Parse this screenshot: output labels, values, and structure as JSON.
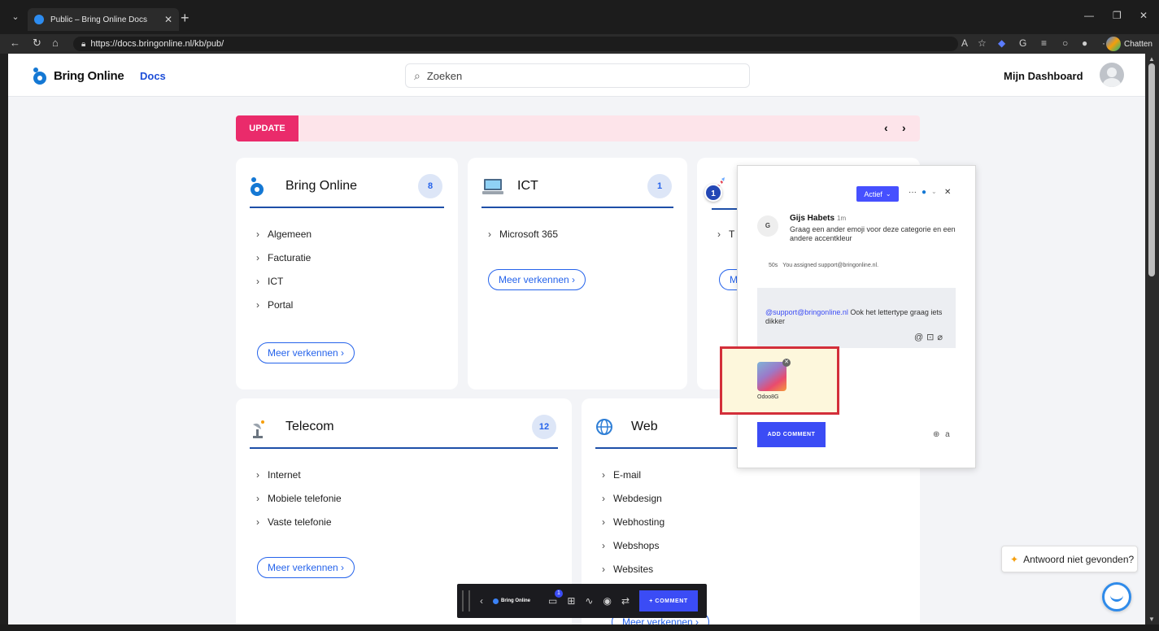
{
  "browser": {
    "tab_title": "Public – Bring Online Docs",
    "url": "https://docs.bringonline.nl/kb/pub/",
    "copilot_label": "Chatten"
  },
  "header": {
    "brand": "Bring Online",
    "docs_link": "Docs",
    "search_placeholder": "Zoeken",
    "dashboard_link": "Mijn Dashboard"
  },
  "update_banner": {
    "label": "UPDATE",
    "prev": "‹",
    "next": "›"
  },
  "cards": [
    {
      "title": "Bring Online",
      "count": "8",
      "links": [
        "Algemeen",
        "Facturatie",
        "ICT",
        "Portal"
      ],
      "explore": "Meer verkennen ›"
    },
    {
      "title": "ICT",
      "count": "1",
      "links": [
        "Microsoft 365"
      ],
      "explore": "Meer verkennen ›"
    },
    {
      "title": "",
      "count": "",
      "links": [
        "T"
      ],
      "explore": "M"
    },
    {
      "title": "Telecom",
      "count": "12",
      "links": [
        "Internet",
        "Mobiele telefonie",
        "Vaste telefonie"
      ],
      "explore": "Meer verkennen ›"
    },
    {
      "title": "Web",
      "count": "",
      "links": [
        "E-mail",
        "Webdesign",
        "Webhosting",
        "Webshops",
        "Websites"
      ],
      "explore": "Meer verkennen ›"
    }
  ],
  "comment_popup": {
    "pin_number": "1",
    "status": "Actief",
    "author_initial": "G",
    "author": "Gijs Habets",
    "time": "1m",
    "text": "Graag een ander emoji voor deze categorie en een andere accentkleur",
    "log_time": "50s",
    "log_text": "You assigned support@bringonline.nl.",
    "reply_mention": "@support@bringonline.nl",
    "reply_text": " Ook het lettertype graag iets dikker",
    "attachment_name": "Odoo8G",
    "add_comment": "ADD COMMENT"
  },
  "toolbar": {
    "brand": "Bring Online",
    "badge": "1",
    "comment_button": "+ COMMENT"
  },
  "help": {
    "label": "Antwoord niet gevonden?"
  },
  "colors": {
    "accent": "#2563eb",
    "update_label": "#ea2b6b",
    "update_bg": "#fde4ea",
    "comment_button": "#3b4cf5",
    "highlight_border": "#d32f3a"
  }
}
